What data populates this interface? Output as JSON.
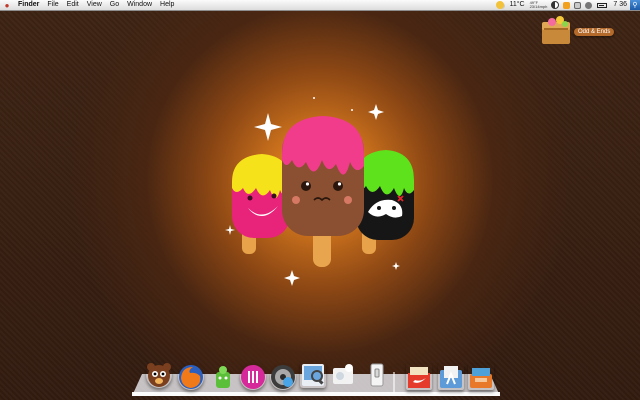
{
  "menubar": {
    "apple": "",
    "items": [
      "Finder",
      "File",
      "Edit",
      "View",
      "Go",
      "Window",
      "Help"
    ],
    "temperature": "11°C",
    "weather_hi": "49°F",
    "weather_lo": "23/14mph",
    "time": "7 36"
  },
  "desktop": {
    "folder_label": "Odd & Ends"
  },
  "dock": {
    "icons": [
      "bear-app-icon",
      "firefox-icon",
      "green-robot-icon",
      "pink-globe-icon",
      "itunes-icon",
      "preview-icon",
      "photos-icon",
      "light-switch-icon",
      "nike-shoebox-icon",
      "applications-stack-icon",
      "documents-stack-icon"
    ]
  },
  "colors": {
    "background": "#3a2112",
    "glow": "#f6a93a",
    "menubar": "#f0f0f0"
  }
}
